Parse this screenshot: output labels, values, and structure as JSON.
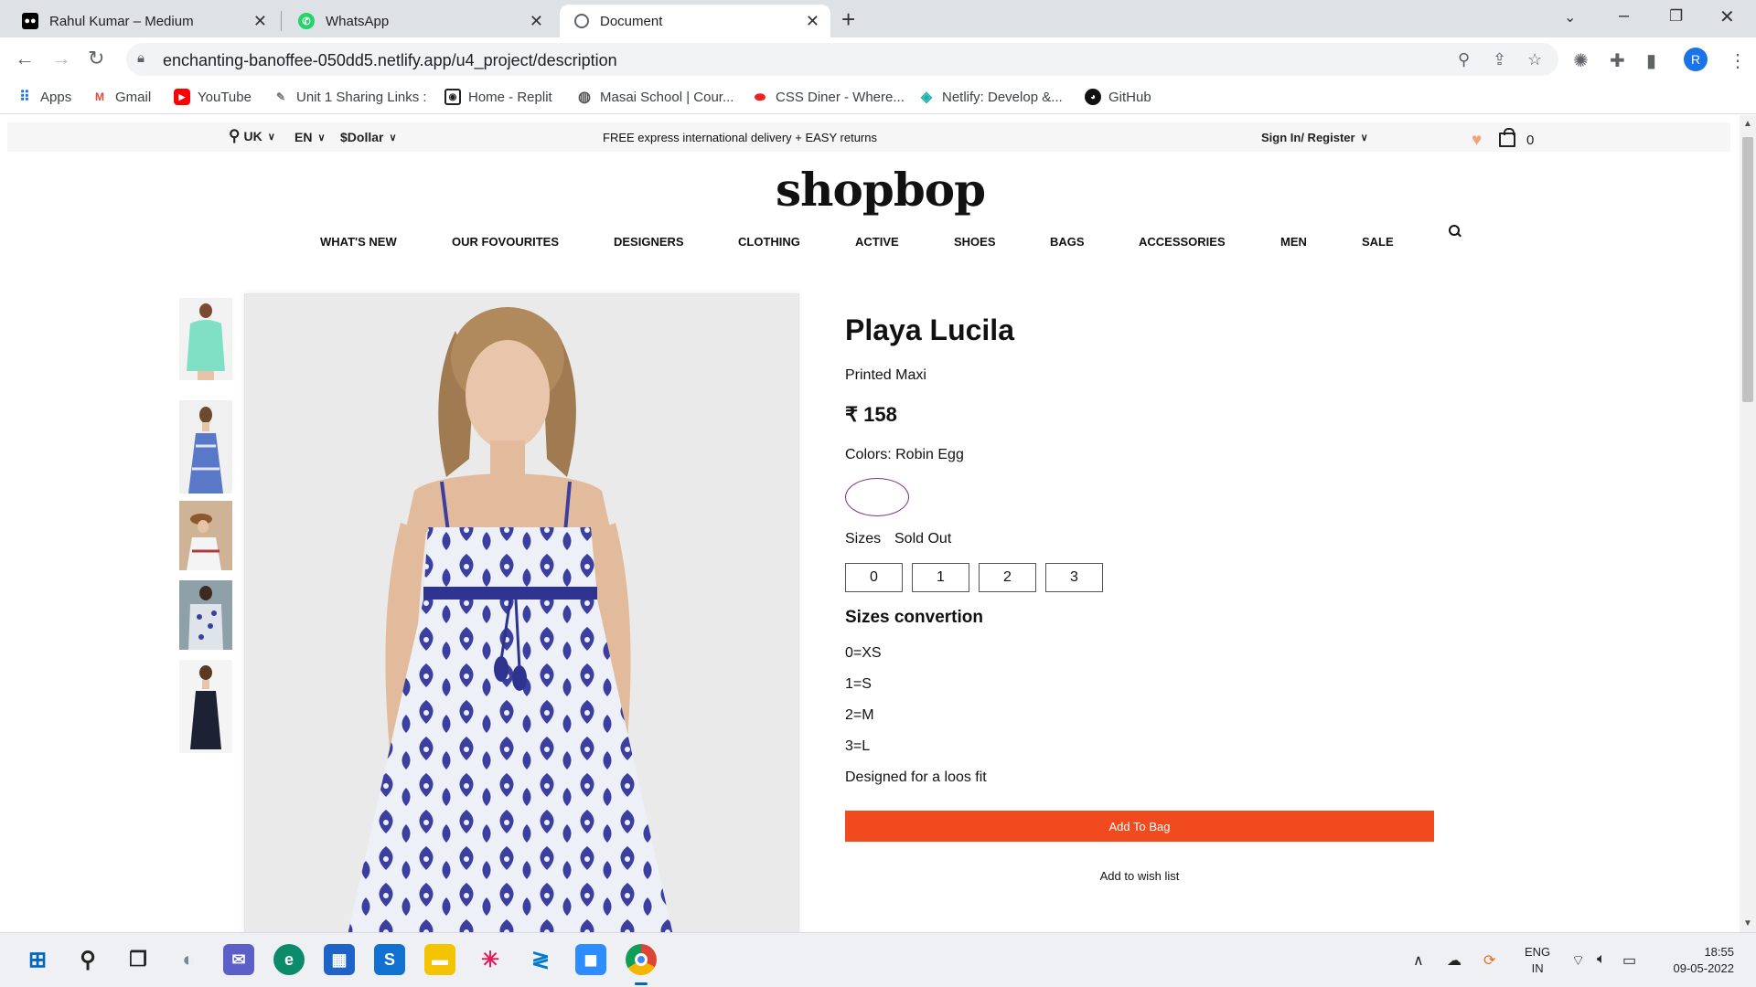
{
  "browser": {
    "tabs": [
      {
        "title": "Rahul Kumar – Medium",
        "icon": "medium-icon"
      },
      {
        "title": "WhatsApp",
        "icon": "whatsapp-icon"
      },
      {
        "title": "Document",
        "icon": "globe-icon"
      }
    ],
    "url": "enchanting-banoffee-050dd5.netlify.app/u4_project/description",
    "profile_initial": "R",
    "bookmarks": [
      {
        "label": "Apps",
        "icon": "apps-grid-icon"
      },
      {
        "label": "Gmail",
        "icon": "gmail-icon"
      },
      {
        "label": "YouTube",
        "icon": "youtube-icon"
      },
      {
        "label": "Unit 1 Sharing Links :",
        "icon": "pin-icon"
      },
      {
        "label": "Home - Replit",
        "icon": "replit-icon"
      },
      {
        "label": "Masai School | Cour...",
        "icon": "globe-icon"
      },
      {
        "label": "CSS Diner - Where...",
        "icon": "css-diner-icon"
      },
      {
        "label": "Netlify: Develop &...",
        "icon": "netlify-icon"
      },
      {
        "label": "GitHub",
        "icon": "github-icon"
      }
    ]
  },
  "site": {
    "topbar": {
      "region": "UK",
      "language": "EN",
      "currency": "$Dollar",
      "promo": "FREE express international delivery + EASY returns",
      "sign_in": "Sign In/ Register",
      "bag_count": "0"
    },
    "logo": "shopbop",
    "nav": [
      "WHAT'S NEW",
      "OUR FOVOURITES",
      "DESIGNERS",
      "CLOTHING",
      "ACTIVE",
      "SHOES",
      "BAGS",
      "ACCESSORIES",
      "MEN",
      "SALE"
    ]
  },
  "product": {
    "title": "Playa Lucila",
    "subtitle": "Printed Maxi",
    "price": "₹ 158",
    "colors_label": "Colors: Robin Egg",
    "sizes_label": "Sizes",
    "sold_out": "Sold Out",
    "sizes": [
      "0",
      "1",
      "2",
      "3"
    ],
    "conversion_title": "Sizes convertion",
    "conversions": [
      "0=XS",
      "1=S",
      "2=M",
      "3=L"
    ],
    "fit_note": "Designed for a loos fit",
    "add_to_bag": "Add To Bag",
    "add_to_wishlist": "Add to wish list"
  },
  "taskbar": {
    "language": "ENG",
    "region": "IN",
    "time": "18:55",
    "date": "09-05-2022"
  },
  "colors": {
    "accent_orange": "#f04a1e",
    "swatch_border": "#7b2c8f",
    "dress_blue": "#3a3fa0"
  }
}
